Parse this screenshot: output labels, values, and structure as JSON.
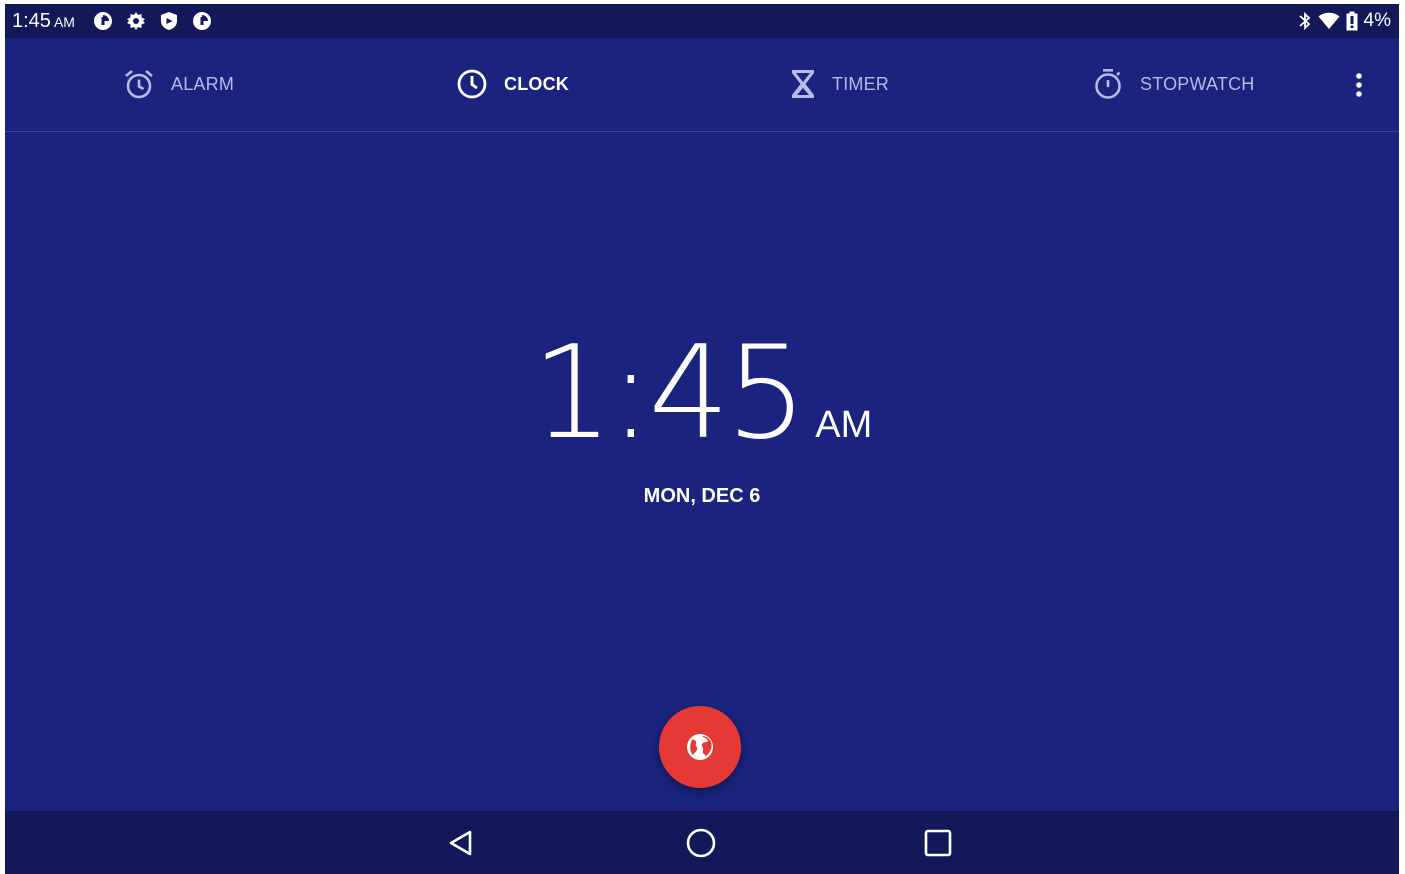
{
  "status_bar": {
    "time": "1:45",
    "ampm": "AM",
    "battery": "4%",
    "left_icons": [
      "data-saver-icon",
      "settings-icon",
      "shield-icon",
      "data-saver-icon"
    ],
    "right_icons": [
      "bluetooth-icon",
      "wifi-icon",
      "battery-icon"
    ]
  },
  "tabs": [
    {
      "label": "ALARM",
      "icon": "alarm-icon",
      "active": false
    },
    {
      "label": "CLOCK",
      "icon": "clock-icon",
      "active": true
    },
    {
      "label": "TIMER",
      "icon": "hourglass-icon",
      "active": false
    },
    {
      "label": "STOPWATCH",
      "icon": "stopwatch-icon",
      "active": false
    }
  ],
  "clock": {
    "time": "1:45",
    "ampm": "AM",
    "date": "MON, DEC 6"
  },
  "fab": {
    "icon": "globe-icon"
  },
  "nav": {
    "icons": [
      "back-icon",
      "home-icon",
      "recents-icon"
    ]
  },
  "colors": {
    "background": "#1a237e",
    "status_bar": "#121858",
    "fab": "#e53935",
    "inactive_tab": "#b7bbe6"
  }
}
